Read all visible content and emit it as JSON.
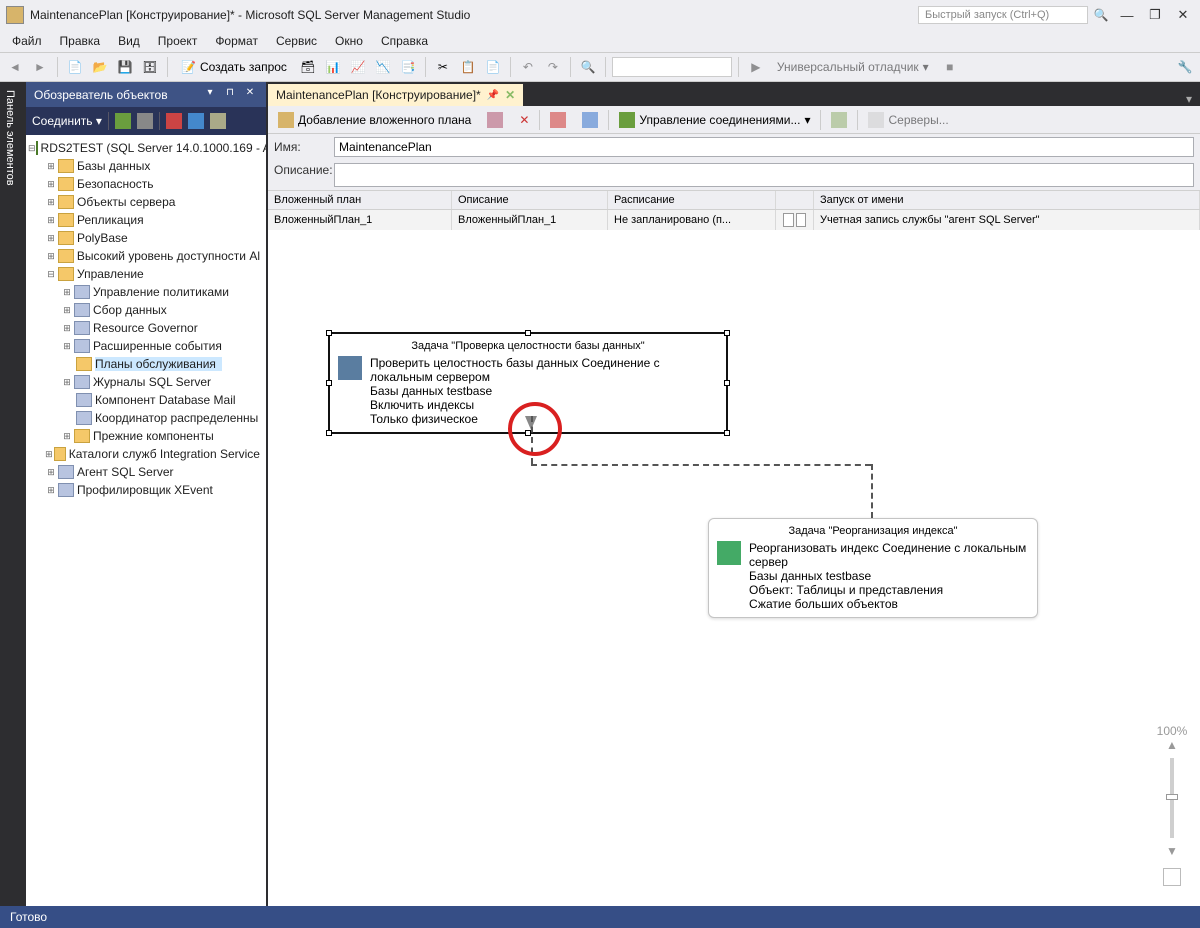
{
  "title": "MaintenancePlan [Конструирование]* - Microsoft SQL Server Management Studio",
  "quicklaunch": "Быстрый запуск (Ctrl+Q)",
  "menu": [
    "Файл",
    "Правка",
    "Вид",
    "Проект",
    "Формат",
    "Сервис",
    "Окно",
    "Справка"
  ],
  "toolbar": {
    "newquery": "Создать запрос",
    "debugger": "Универсальный отладчик"
  },
  "sidebar": {
    "tab": "Панель элементов",
    "title": "Обозреватель объектов",
    "connect": "Соединить",
    "root": "RDS2TEST (SQL Server 14.0.1000.169 - A",
    "nodes": {
      "n0": "Базы данных",
      "n1": "Безопасность",
      "n2": "Объекты сервера",
      "n3": "Репликация",
      "n4": "PolyBase",
      "n5": "Высокий уровень доступности Al",
      "n6": "Управление",
      "n7": "Управление политиками",
      "n8": "Сбор данных",
      "n9": "Resource Governor",
      "n10": "Расширенные события",
      "n11": "Планы обслуживания",
      "n12": "Журналы SQL Server",
      "n13": "Компонент Database Mail",
      "n14": "Координатор распределенны",
      "n15": "Прежние компоненты",
      "n16": "Каталоги служб Integration Service",
      "n17": "Агент SQL Server",
      "n18": "Профилировщик XEvent"
    }
  },
  "document": {
    "tab": "MaintenancePlan [Конструирование]*",
    "ptoolbar": {
      "addsub": "Добавление вложенного плана",
      "conn": "Управление соединениями...",
      "servers": "Серверы..."
    },
    "form": {
      "name_label": "Имя:",
      "name_value": "MaintenancePlan",
      "desc_label": "Описание:",
      "desc_value": ""
    },
    "grid": {
      "headers": {
        "h1": "Вложенный план",
        "h2": "Описание",
        "h3": "Расписание",
        "h4": "",
        "h5": "Запуск от имени"
      },
      "row": {
        "c1": "ВложенныйПлан_1",
        "c2": "ВложенныйПлан_1",
        "c3": "Не запланировано (п...",
        "c5": "Учетная запись службы \"агент SQL Server\""
      }
    },
    "task1": {
      "title": "Задача \"Проверка целостности базы данных\"",
      "l1": "Проверить целостность базы данных Соединение с локальным сервером",
      "l2": "Базы данных testbase",
      "l3": "Включить индексы",
      "l4": "Только физическое"
    },
    "task2": {
      "title": "Задача \"Реорганизация индекса\"",
      "l1": "Реорганизовать индекс Соединение с локальным сервер",
      "l2": "Базы данных testbase",
      "l3": "Объект: Таблицы и представления",
      "l4": "Сжатие больших объектов"
    },
    "zoom": "100%"
  },
  "status": "Готово"
}
